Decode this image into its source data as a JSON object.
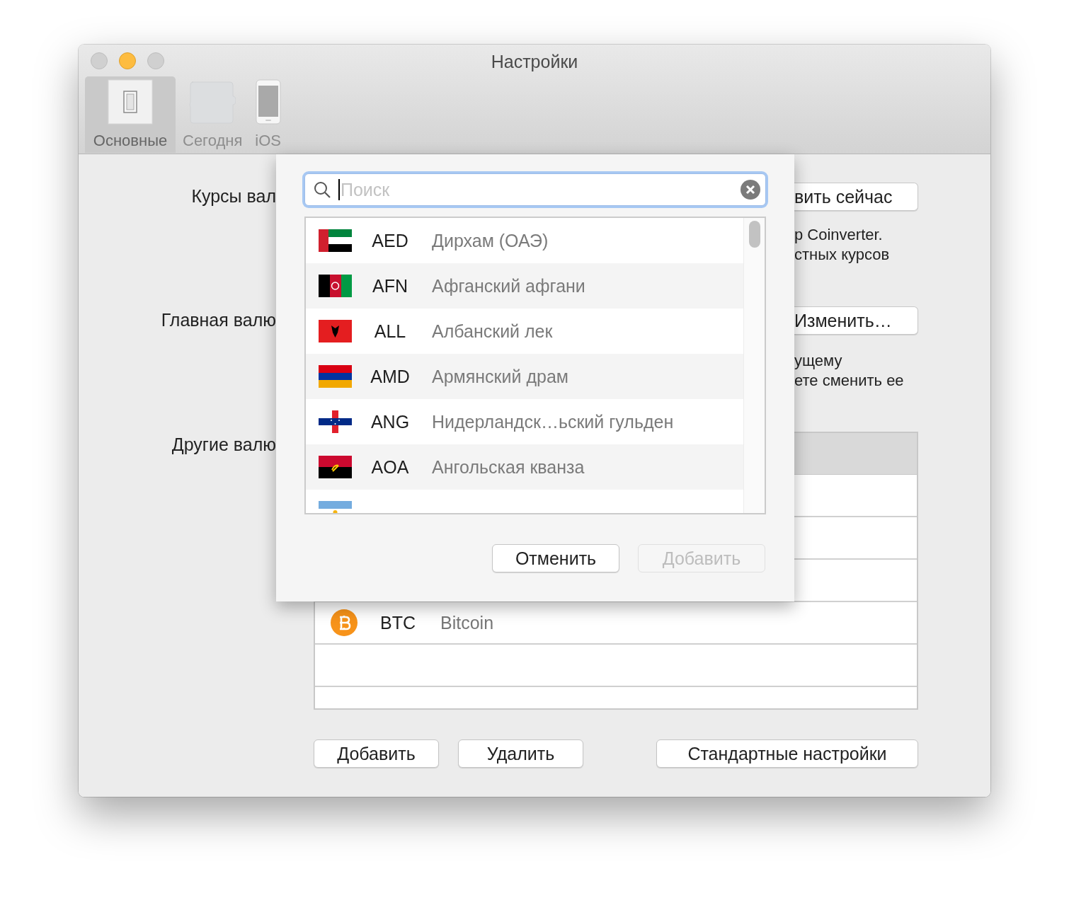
{
  "window": {
    "title": "Настройки",
    "controls": [
      {
        "kind": "close",
        "enabled": false
      },
      {
        "kind": "minimize",
        "enabled": true
      },
      {
        "kind": "zoom",
        "enabled": false
      }
    ]
  },
  "toolbar": [
    {
      "label": "Основные",
      "kind": "switch",
      "selected": true
    },
    {
      "label": "Сегодня",
      "kind": "puzzle",
      "selected": false
    },
    {
      "label": "iOS",
      "kind": "phone",
      "selected": false
    }
  ],
  "settings": {
    "rates_label": "Курсы вал",
    "update_button": "вить сейчас",
    "rates_note": [
      "p Coinverter.",
      "стных курсов"
    ],
    "main_label": "Главная валю",
    "change_button": "Изменить…",
    "main_note": [
      "ущему",
      "ете сменить ее"
    ],
    "others_label": "Другие валю",
    "table": {
      "rows": [
        {
          "code": "BTC",
          "name": "Bitcoin",
          "kind": "bitcoin"
        }
      ]
    },
    "buttons": [
      "Добавить",
      "Удалить",
      "Стандартные настройки"
    ]
  },
  "sheet": {
    "search": {
      "placeholder": "Поиск",
      "focused": true
    },
    "currencies": [
      {
        "kind": "ae",
        "code": "AED",
        "name": "Дирхам (ОАЭ)"
      },
      {
        "kind": "af",
        "code": "AFN",
        "name": "Афганский афгани"
      },
      {
        "kind": "al",
        "code": "ALL",
        "name": "Албанский лек"
      },
      {
        "kind": "am",
        "code": "AMD",
        "name": "Армянский драм"
      },
      {
        "kind": "an",
        "code": "ANG",
        "name": "Нидерландск…ьский гульден"
      },
      {
        "kind": "ao",
        "code": "AOA",
        "name": "Ангольская кванза"
      },
      {
        "kind": "ar"
      }
    ],
    "buttons": [
      {
        "label": "Отменить",
        "disabled": false
      },
      {
        "label": "Добавить",
        "disabled": true
      }
    ]
  }
}
